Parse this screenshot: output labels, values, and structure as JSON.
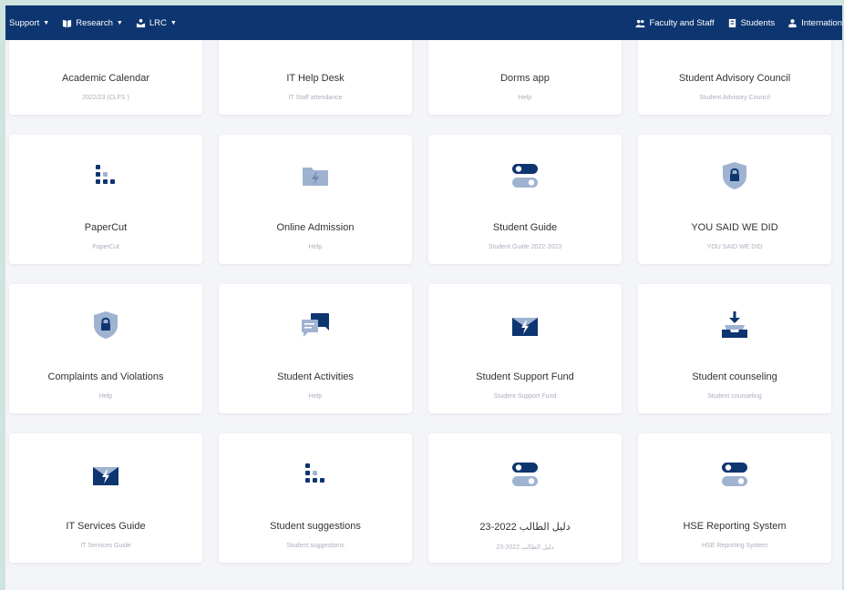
{
  "nav": {
    "left": [
      {
        "label": "Support",
        "icon": "none"
      },
      {
        "label": "Research",
        "icon": "book-icon"
      },
      {
        "label": "LRC",
        "icon": "library-icon"
      }
    ],
    "right": [
      {
        "label": "Faculty and Staff",
        "icon": "users-icon"
      },
      {
        "label": "Students",
        "icon": "id-card-icon"
      },
      {
        "label": "Internation",
        "icon": "globe-user-icon"
      }
    ]
  },
  "colors": {
    "topbar": "#0d3570",
    "icon_dark": "#0d3570",
    "icon_light": "#9fb3d1",
    "background": "#f4f5f8"
  },
  "cards": [
    {
      "title": "Academic Calendar",
      "subtitle": "2022/23 (CLFS )",
      "icon": "chat-icon"
    },
    {
      "title": "IT Help Desk",
      "subtitle": "IT Staff attendance",
      "icon": "envelope-bolt-icon"
    },
    {
      "title": "Dorms app",
      "subtitle": "Help",
      "icon": "inbox-download-icon"
    },
    {
      "title": "Student Advisory Council",
      "subtitle": "Student Advisory Council",
      "icon": "flag-icon"
    },
    {
      "title": "PaperCut",
      "subtitle": "PaperCut",
      "icon": "dots-grid-icon"
    },
    {
      "title": "Online Admission",
      "subtitle": "Help",
      "icon": "folder-bolt-icon"
    },
    {
      "title": "Student Guide",
      "subtitle": "Student Guide 2022-2023",
      "icon": "toggle-icon"
    },
    {
      "title": "YOU SAID WE DID",
      "subtitle": "YOU SAID WE DID",
      "icon": "shield-lock-icon"
    },
    {
      "title": "Complaints and Violations",
      "subtitle": "Help",
      "icon": "shield-lock-icon"
    },
    {
      "title": "Student Activities",
      "subtitle": "Help",
      "icon": "chat-icon"
    },
    {
      "title": "Student Support Fund",
      "subtitle": "Student Support Fund",
      "icon": "envelope-bolt-icon"
    },
    {
      "title": "Student counseling",
      "subtitle": "Student counseling",
      "icon": "inbox-download-icon"
    },
    {
      "title": "IT Services Guide",
      "subtitle": "IT Services Guide",
      "icon": "envelope-bolt-icon"
    },
    {
      "title": "Student suggestions",
      "subtitle": "Student suggestions",
      "icon": "dots-grid-icon"
    },
    {
      "title": "دليل الطالب 2022-23",
      "subtitle": "دليل الطالب 2022-23",
      "icon": "toggle-icon"
    },
    {
      "title": "HSE Reporting System",
      "subtitle": "HSE Reporting System",
      "icon": "toggle-icon"
    }
  ]
}
